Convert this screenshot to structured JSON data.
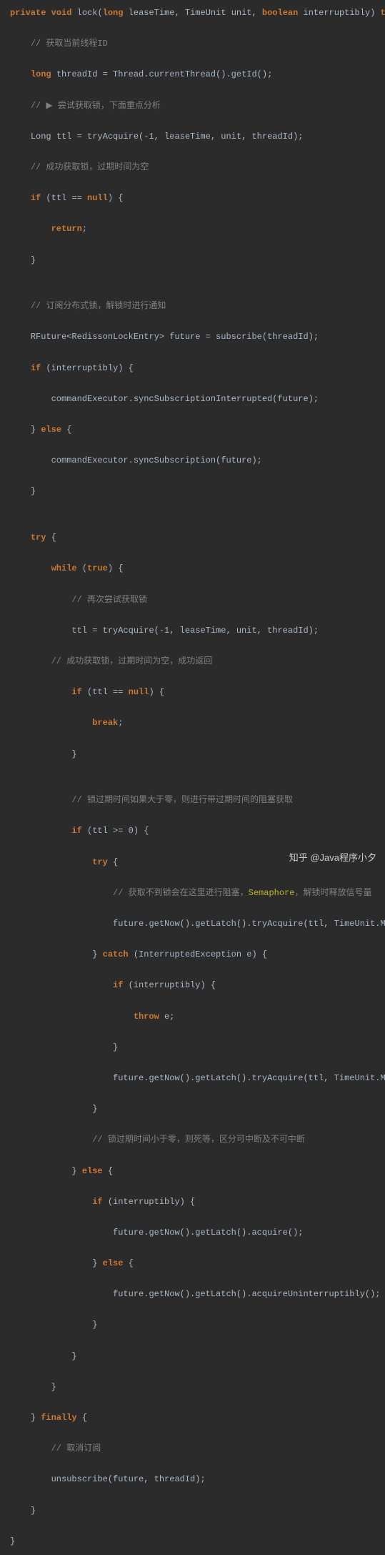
{
  "code": {
    "l1_private": "private",
    "l1_void": "void",
    "l1_lock": " lock(",
    "l1_long": "long",
    "l1_rest1": " leaseTime, TimeUnit unit, ",
    "l1_boolean": "boolean",
    "l1_rest2": " interruptibly) ",
    "l1_th": "t",
    "cmt_threadId": "// 获取当前线程ID",
    "l3_long": "long",
    "l3_rest": " threadId = Thread.currentThread().getId();",
    "cmt_tryAcquire": "// ",
    "cmt_tryAcquire_arrow": "▶",
    "cmt_tryAcquire2": " 尝试获取锁，下面重点分析",
    "l5": "Long ttl = tryAcquire(-1, leaseTime, unit, threadId);",
    "cmt_success": "// 成功获取锁，过期时间为空",
    "l7_if": "if",
    "l7_mid": " (ttl == ",
    "l7_null": "null",
    "l7_end": ") {",
    "l8_return": "return",
    "l8_semi": ";",
    "l9": "}",
    "cmt_subscribe": "// 订阅分布式锁，解锁时进行通知",
    "l11": "RFuture<RedissonLockEntry> future = subscribe(threadId);",
    "l12_if": "if",
    "l12_rest": " (interruptibly) {",
    "l13": "commandExecutor.syncSubscriptionInterrupted(future);",
    "l14_a": "} ",
    "l14_else": "else",
    "l14_b": " {",
    "l15": "commandExecutor.syncSubscription(future);",
    "l16": "}",
    "l18_try": "try",
    "l18_b": " {",
    "l19_while": "while",
    "l19_a": " (",
    "l19_true": "true",
    "l19_b": ") {",
    "cmt_retry": "// 再次尝试获取锁",
    "l21": "ttl = tryAcquire(-1, leaseTime, unit, threadId);",
    "cmt_success2": "// 成功获取锁，过期时间为空，成功返回",
    "l23_if": "if",
    "l23_a": " (ttl == ",
    "l23_null": "null",
    "l23_b": ") {",
    "l24_break": "break",
    "l24_semi": ";",
    "l25": "}",
    "cmt_gt0": "// 锁过期时间如果大于零，则进行带过期时间的阻塞获取",
    "l27_if": "if",
    "l27_rest": " (ttl >= 0) {",
    "l28_try": "try",
    "l28_b": " {",
    "cmt_block_a": "// 获取不到锁会在这里进行阻塞，",
    "cmt_block_sem": "Semaphore",
    "cmt_block_b": "，解锁时释放信号量",
    "l30": "future.getNow().getLatch().tryAcquire(ttl, TimeUnit.MI",
    "l31_a": "} ",
    "l31_catch": "catch",
    "l31_b": " (InterruptedException e) {",
    "l32_if": "if",
    "l32_rest": " (interruptibly) {",
    "l33_throw": "throw",
    "l33_rest": " e;",
    "l34": "}",
    "l35": "future.getNow().getLatch().tryAcquire(ttl, TimeUnit.MI",
    "l36": "}",
    "cmt_lt0": "// 锁过期时间小于零，则死等，区分可中断及不可中断",
    "l38_a": "} ",
    "l38_else": "else",
    "l38_b": " {",
    "l39_if": "if",
    "l39_rest": " (interruptibly) {",
    "l40": "future.getNow().getLatch().acquire();",
    "l41_a": "} ",
    "l41_else": "else",
    "l41_b": " {",
    "l42": "future.getNow().getLatch().acquireUninterruptibly();",
    "l43": "}",
    "l44": "}",
    "l45": "}",
    "l46_a": "} ",
    "l46_finally": "finally",
    "l46_b": " {",
    "cmt_unsub": "// 取消订阅",
    "l48": "unsubscribe(future, threadId);",
    "l49": "}",
    "l50": "}"
  },
  "watermark": "知乎 @Java程序小夕"
}
